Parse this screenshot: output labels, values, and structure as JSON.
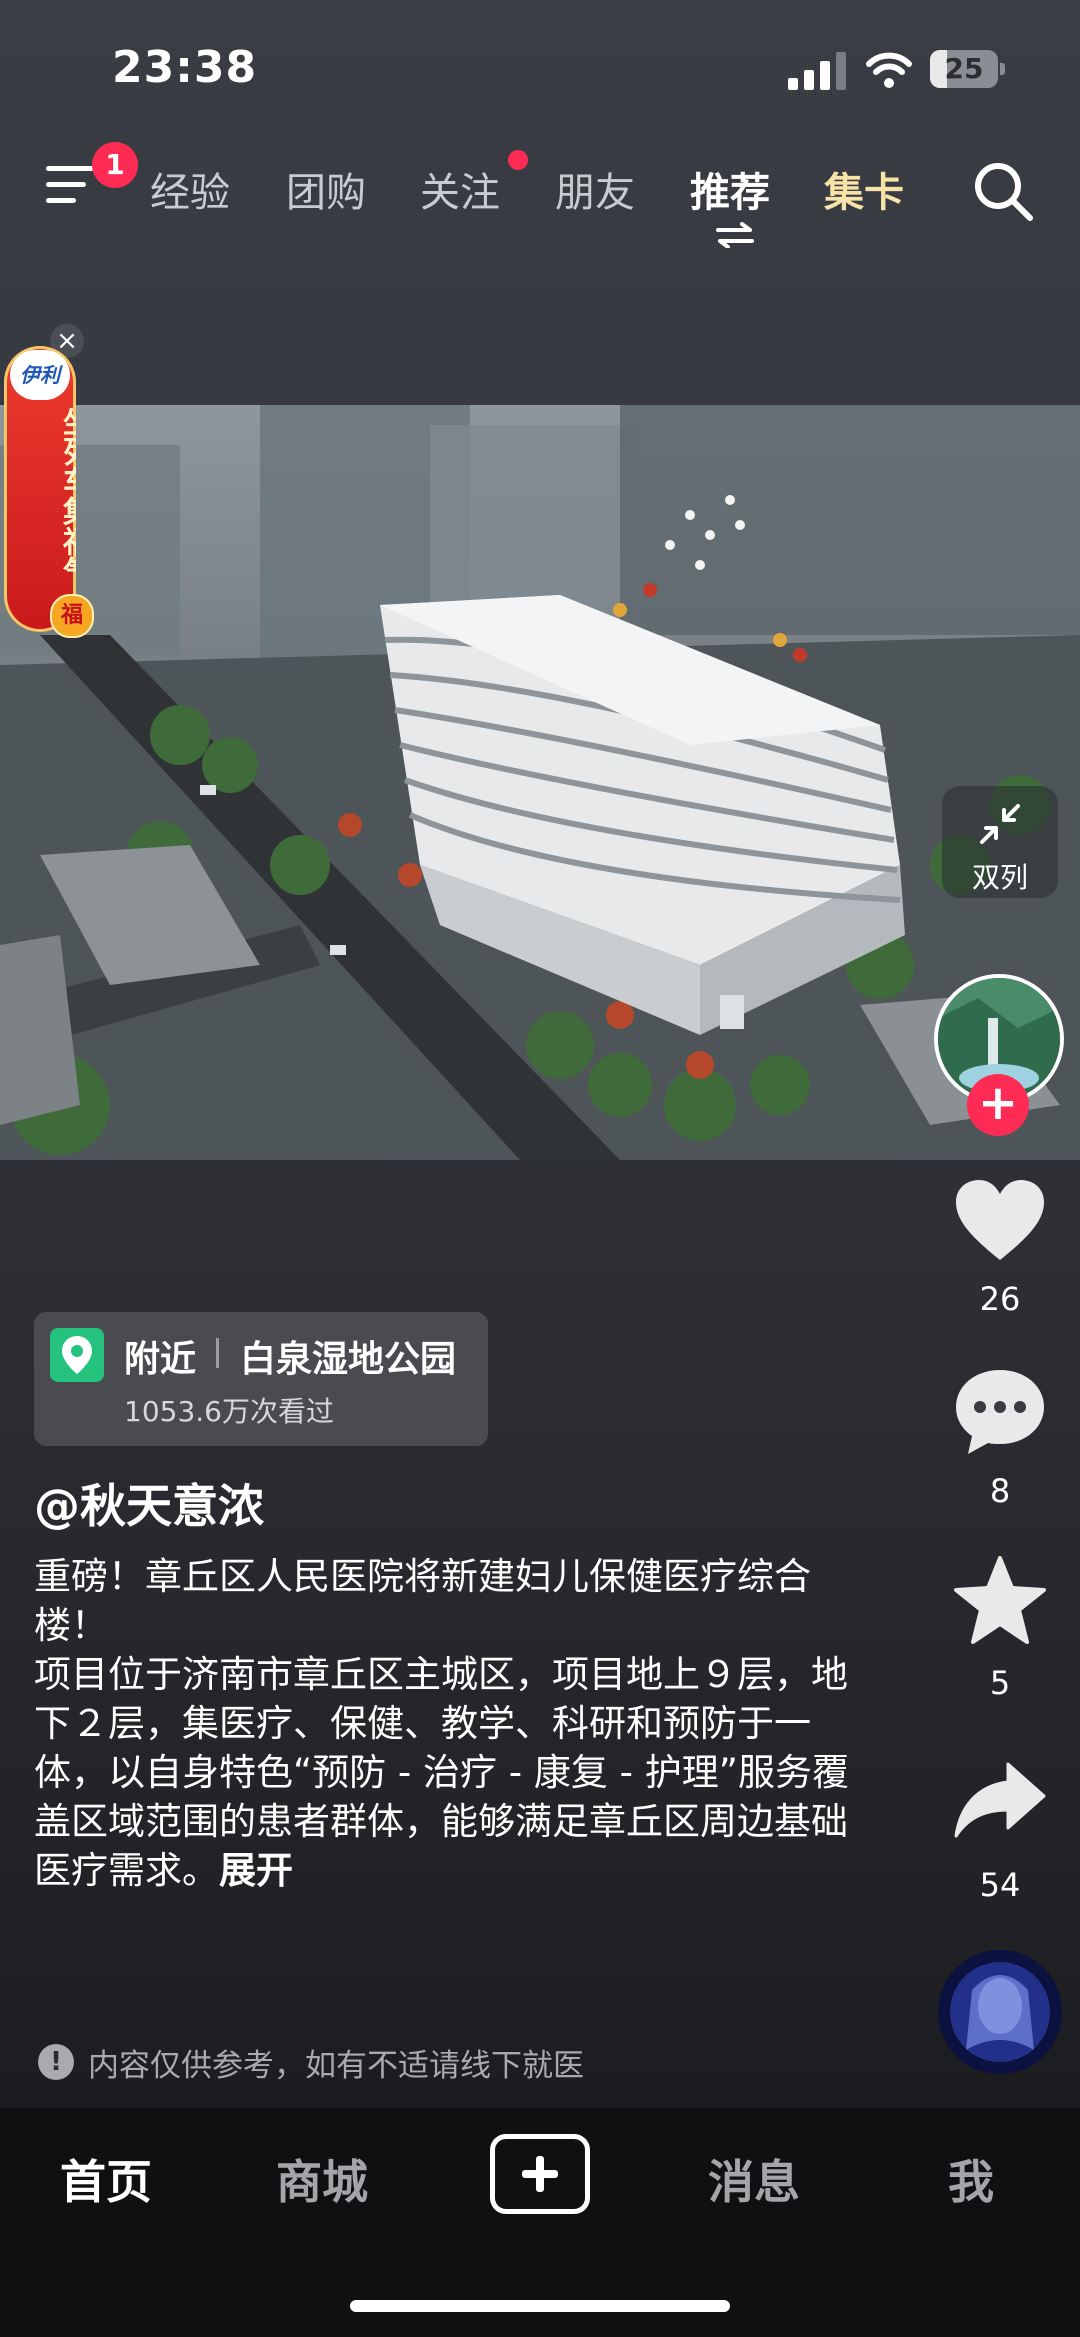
{
  "status_bar": {
    "time": "23:38",
    "battery": "25",
    "battery_level": 0.25
  },
  "top_nav": {
    "menu_badge": "1",
    "tabs": [
      {
        "label": "经验"
      },
      {
        "label": "团购"
      },
      {
        "label": "关注",
        "has_dot": true
      },
      {
        "label": "朋友"
      },
      {
        "label": "推荐",
        "active": true
      },
      {
        "label": "集卡"
      }
    ]
  },
  "ad": {
    "brand": "伊利",
    "text": "坐列车集福气",
    "badge": "福",
    "close": "×"
  },
  "dual_column": {
    "label": "双列"
  },
  "actions": {
    "likes": "26",
    "comments": "8",
    "favorites": "5",
    "shares": "54",
    "follow": "+"
  },
  "location": {
    "nearby": "附近",
    "place": "白泉湿地公园",
    "views": "1053.6万次看过"
  },
  "post": {
    "author": "@秋天意浓",
    "line1": "重磅！章丘区人民医院将新建妇儿保健医疗综合楼！",
    "line2": "项目位于济南市章丘区主城区，项目地上９层，地下２层，集医疗、保健、教学、科研和预防于一体，以自身特色“预防 - 治疗 - 康复 - 护理”服务覆盖区域范围的患者群体，能够满足章丘区周边基础医疗需求。",
    "expand": "展开"
  },
  "disclaimer": {
    "icon": "!",
    "text": "内容仅供参考，如有不适请线下就医"
  },
  "bottom_nav": {
    "home": "首页",
    "mall": "商城",
    "messages": "消息",
    "me": "我"
  },
  "colors": {
    "accent": "#fe2c55",
    "gold_tab": "#f7e3a8",
    "location_pin": "#25c27d"
  },
  "icons": [
    "menu-icon",
    "swap-icon",
    "search-icon",
    "close-icon",
    "collapse-arrows-icon",
    "heart-icon",
    "comment-icon",
    "star-icon",
    "share-icon",
    "location-pin-icon",
    "warning-icon",
    "plus-icon"
  ]
}
